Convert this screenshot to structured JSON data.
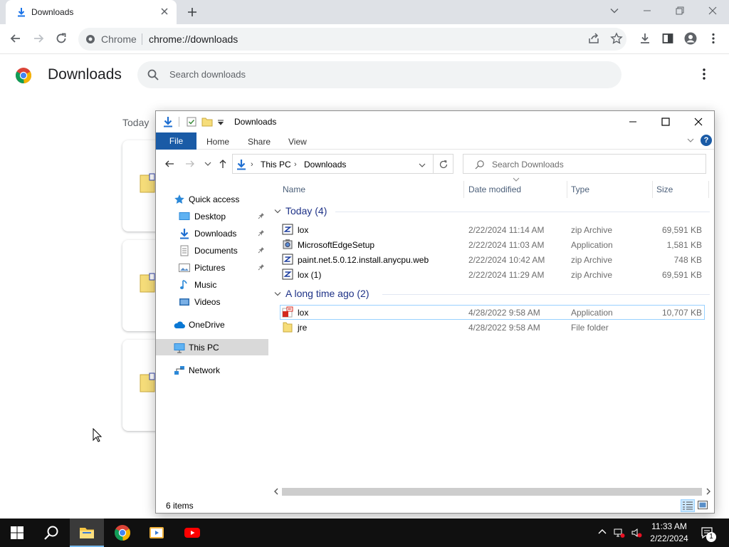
{
  "browser": {
    "tab_title": "Downloads",
    "omnibox_chip": "Chrome",
    "url": "chrome://downloads"
  },
  "downloads_page": {
    "title": "Downloads",
    "search_placeholder": "Search downloads",
    "date_heading": "Today"
  },
  "explorer": {
    "window_title": "Downloads",
    "ribbon": {
      "file": "File",
      "home": "Home",
      "share": "Share",
      "view": "View",
      "help": "?"
    },
    "breadcrumb": [
      "This PC",
      "Downloads"
    ],
    "search_placeholder": "Search Downloads",
    "nav": {
      "quick_access": "Quick access",
      "desktop": "Desktop",
      "downloads": "Downloads",
      "documents": "Documents",
      "pictures": "Pictures",
      "music": "Music",
      "videos": "Videos",
      "onedrive": "OneDrive",
      "this_pc": "This PC",
      "network": "Network"
    },
    "columns": {
      "name": "Name",
      "date": "Date modified",
      "type": "Type",
      "size": "Size"
    },
    "groups": {
      "today": {
        "label": "Today (4)",
        "files": [
          {
            "name": "lox",
            "date": "2/22/2024 11:14 AM",
            "type": "zip Archive",
            "size": "69,591 KB",
            "icon": "zip-icon"
          },
          {
            "name": "MicrosoftEdgeSetup",
            "date": "2/22/2024 11:03 AM",
            "type": "Application",
            "size": "1,581 KB",
            "icon": "installer-icon"
          },
          {
            "name": "paint.net.5.0.12.install.anycpu.web",
            "date": "2/22/2024 10:42 AM",
            "type": "zip Archive",
            "size": "748 KB",
            "icon": "zip-icon"
          },
          {
            "name": "lox (1)",
            "date": "2/22/2024 11:29 AM",
            "type": "zip Archive",
            "size": "69,591 KB",
            "icon": "zip-icon"
          }
        ]
      },
      "long_ago": {
        "label": "A long time ago (2)",
        "files": [
          {
            "name": "lox",
            "date": "4/28/2022 9:58 AM",
            "type": "Application",
            "size": "10,707 KB",
            "icon": "app-icon"
          },
          {
            "name": "jre",
            "date": "4/28/2022 9:58 AM",
            "type": "File folder",
            "size": "",
            "icon": "folder-icon"
          }
        ]
      }
    },
    "status": "6 items"
  },
  "taskbar": {
    "time": "11:33 AM",
    "date": "2/22/2024",
    "notifications": "1"
  },
  "colors": {
    "accent_blue": "#1a5ba6",
    "selection": "#cce8ff",
    "selection_border": "#99d1ff",
    "group_header": "#1e3287",
    "taskbar": "#101010"
  }
}
